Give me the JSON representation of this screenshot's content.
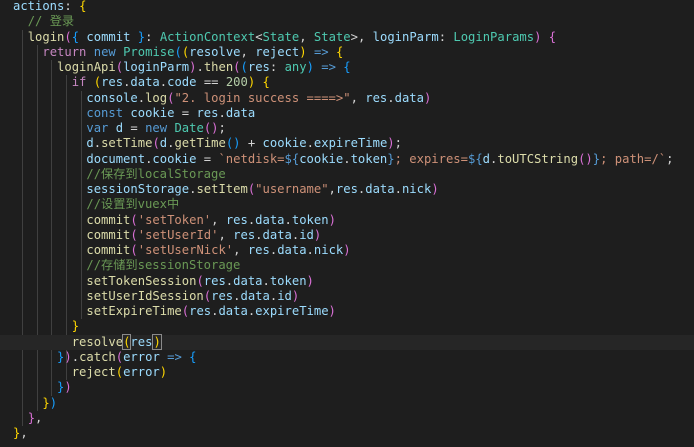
{
  "colors": {
    "background": "#1e1e1e",
    "default": "#d4d4d4",
    "keyword": "#569cd6",
    "control": "#c586c0",
    "variable": "#9cdcfe",
    "function": "#dcdcaa",
    "type": "#4ec9b0",
    "string": "#ce9178",
    "number": "#b5cea8",
    "comment": "#6a9955",
    "bracket1": "#ffd700",
    "bracket2": "#da70d6",
    "bracket3": "#179fff"
  },
  "lines": [
    {
      "tokens": [
        [
          "actions",
          "variable"
        ],
        [
          ": ",
          "default"
        ],
        [
          "{",
          "bracket1"
        ]
      ]
    },
    {
      "tokens": [
        [
          "  ",
          "default"
        ],
        [
          "// 登录",
          "comment"
        ]
      ]
    },
    {
      "tokens": [
        [
          "  ",
          "default"
        ],
        [
          "login",
          "function"
        ],
        [
          "(",
          "bracket2"
        ],
        [
          "{ ",
          "bracket3"
        ],
        [
          "commit ",
          "variable"
        ],
        [
          "}",
          "bracket3"
        ],
        [
          ": ",
          "default"
        ],
        [
          "ActionContext",
          "type"
        ],
        [
          "<",
          "default"
        ],
        [
          "State",
          "type"
        ],
        [
          ", ",
          "default"
        ],
        [
          "State",
          "type"
        ],
        [
          ">",
          "default"
        ],
        [
          ", ",
          "default"
        ],
        [
          "loginParm",
          "variable"
        ],
        [
          ": ",
          "default"
        ],
        [
          "LoginParams",
          "type"
        ],
        [
          ")",
          "bracket2"
        ],
        [
          " ",
          "default"
        ],
        [
          "{",
          "bracket2"
        ]
      ]
    },
    {
      "tokens": [
        [
          "    ",
          "default"
        ],
        [
          "return ",
          "control"
        ],
        [
          "new ",
          "keyword"
        ],
        [
          "Promise",
          "type"
        ],
        [
          "(",
          "bracket3"
        ],
        [
          "(",
          "bracket1"
        ],
        [
          "resolve",
          "variable"
        ],
        [
          ", ",
          "default"
        ],
        [
          "reject",
          "variable"
        ],
        [
          ")",
          "bracket1"
        ],
        [
          " ",
          "default"
        ],
        [
          "=>",
          "keyword"
        ],
        [
          " ",
          "default"
        ],
        [
          "{",
          "bracket1"
        ]
      ]
    },
    {
      "tokens": [
        [
          "      ",
          "default"
        ],
        [
          "loginApi",
          "function"
        ],
        [
          "(",
          "bracket2"
        ],
        [
          "loginParm",
          "variable"
        ],
        [
          ")",
          "bracket2"
        ],
        [
          ".",
          "default"
        ],
        [
          "then",
          "function"
        ],
        [
          "(",
          "bracket2"
        ],
        [
          "(",
          "bracket3"
        ],
        [
          "res",
          "variable"
        ],
        [
          ": ",
          "default"
        ],
        [
          "any",
          "type"
        ],
        [
          ")",
          "bracket3"
        ],
        [
          " ",
          "default"
        ],
        [
          "=>",
          "keyword"
        ],
        [
          " ",
          "default"
        ],
        [
          "{",
          "bracket3"
        ]
      ]
    },
    {
      "tokens": [
        [
          "        ",
          "default"
        ],
        [
          "if ",
          "control"
        ],
        [
          "(",
          "bracket1"
        ],
        [
          "res",
          "variable"
        ],
        [
          ".",
          "default"
        ],
        [
          "data",
          "variable"
        ],
        [
          ".",
          "default"
        ],
        [
          "code",
          "variable"
        ],
        [
          " == ",
          "default"
        ],
        [
          "200",
          "number"
        ],
        [
          ")",
          "bracket1"
        ],
        [
          " ",
          "default"
        ],
        [
          "{",
          "bracket1"
        ]
      ]
    },
    {
      "tokens": [
        [
          "          ",
          "default"
        ],
        [
          "console",
          "variable"
        ],
        [
          ".",
          "default"
        ],
        [
          "log",
          "function"
        ],
        [
          "(",
          "bracket2"
        ],
        [
          "\"2. login success ====>\"",
          "string"
        ],
        [
          ", ",
          "default"
        ],
        [
          "res",
          "variable"
        ],
        [
          ".",
          "default"
        ],
        [
          "data",
          "variable"
        ],
        [
          ")",
          "bracket2"
        ]
      ]
    },
    {
      "tokens": [
        [
          "          ",
          "default"
        ],
        [
          "const ",
          "keyword"
        ],
        [
          "cookie",
          "variable"
        ],
        [
          " = ",
          "default"
        ],
        [
          "res",
          "variable"
        ],
        [
          ".",
          "default"
        ],
        [
          "data",
          "variable"
        ]
      ]
    },
    {
      "tokens": [
        [
          "          ",
          "default"
        ],
        [
          "var ",
          "keyword"
        ],
        [
          "d",
          "variable"
        ],
        [
          " = ",
          "default"
        ],
        [
          "new ",
          "keyword"
        ],
        [
          "Date",
          "type"
        ],
        [
          "()",
          "bracket2"
        ],
        [
          ";",
          "default"
        ]
      ]
    },
    {
      "tokens": [
        [
          "          ",
          "default"
        ],
        [
          "d",
          "variable"
        ],
        [
          ".",
          "default"
        ],
        [
          "setTime",
          "function"
        ],
        [
          "(",
          "bracket2"
        ],
        [
          "d",
          "variable"
        ],
        [
          ".",
          "default"
        ],
        [
          "getTime",
          "function"
        ],
        [
          "()",
          "bracket3"
        ],
        [
          " + ",
          "default"
        ],
        [
          "cookie",
          "variable"
        ],
        [
          ".",
          "default"
        ],
        [
          "expireTime",
          "variable"
        ],
        [
          ")",
          "bracket2"
        ],
        [
          ";",
          "default"
        ]
      ]
    },
    {
      "tokens": [
        [
          "          ",
          "default"
        ],
        [
          "document",
          "variable"
        ],
        [
          ".",
          "default"
        ],
        [
          "cookie",
          "variable"
        ],
        [
          " = ",
          "default"
        ],
        [
          "`netdisk=",
          "string"
        ],
        [
          "${",
          "keyword"
        ],
        [
          "cookie",
          "variable"
        ],
        [
          ".",
          "default"
        ],
        [
          "token",
          "variable"
        ],
        [
          "}",
          "keyword"
        ],
        [
          "; expires=",
          "string"
        ],
        [
          "${",
          "keyword"
        ],
        [
          "d",
          "variable"
        ],
        [
          ".",
          "default"
        ],
        [
          "toUTCString",
          "function"
        ],
        [
          "()",
          "bracket2"
        ],
        [
          "}",
          "keyword"
        ],
        [
          "; path=/`",
          "string"
        ],
        [
          ";",
          "default"
        ]
      ]
    },
    {
      "tokens": [
        [
          "          ",
          "default"
        ],
        [
          "//保存到localStorage",
          "comment"
        ]
      ]
    },
    {
      "tokens": [
        [
          "          ",
          "default"
        ],
        [
          "sessionStorage",
          "variable"
        ],
        [
          ".",
          "default"
        ],
        [
          "setItem",
          "function"
        ],
        [
          "(",
          "bracket2"
        ],
        [
          "\"username\"",
          "string"
        ],
        [
          ",",
          "default"
        ],
        [
          "res",
          "variable"
        ],
        [
          ".",
          "default"
        ],
        [
          "data",
          "variable"
        ],
        [
          ".",
          "default"
        ],
        [
          "nick",
          "variable"
        ],
        [
          ")",
          "bracket2"
        ]
      ]
    },
    {
      "tokens": [
        [
          "          ",
          "default"
        ],
        [
          "//设置到vuex中",
          "comment"
        ]
      ]
    },
    {
      "tokens": [
        [
          "          ",
          "default"
        ],
        [
          "commit",
          "function"
        ],
        [
          "(",
          "bracket2"
        ],
        [
          "'setToken'",
          "string"
        ],
        [
          ", ",
          "default"
        ],
        [
          "res",
          "variable"
        ],
        [
          ".",
          "default"
        ],
        [
          "data",
          "variable"
        ],
        [
          ".",
          "default"
        ],
        [
          "token",
          "variable"
        ],
        [
          ")",
          "bracket2"
        ]
      ]
    },
    {
      "tokens": [
        [
          "          ",
          "default"
        ],
        [
          "commit",
          "function"
        ],
        [
          "(",
          "bracket2"
        ],
        [
          "'setUserId'",
          "string"
        ],
        [
          ", ",
          "default"
        ],
        [
          "res",
          "variable"
        ],
        [
          ".",
          "default"
        ],
        [
          "data",
          "variable"
        ],
        [
          ".",
          "default"
        ],
        [
          "id",
          "variable"
        ],
        [
          ")",
          "bracket2"
        ]
      ]
    },
    {
      "tokens": [
        [
          "          ",
          "default"
        ],
        [
          "commit",
          "function"
        ],
        [
          "(",
          "bracket2"
        ],
        [
          "'setUserNick'",
          "string"
        ],
        [
          ", ",
          "default"
        ],
        [
          "res",
          "variable"
        ],
        [
          ".",
          "default"
        ],
        [
          "data",
          "variable"
        ],
        [
          ".",
          "default"
        ],
        [
          "nick",
          "variable"
        ],
        [
          ")",
          "bracket2"
        ]
      ]
    },
    {
      "tokens": [
        [
          "          ",
          "default"
        ],
        [
          "//存储到sessionStorage",
          "comment"
        ]
      ]
    },
    {
      "tokens": [
        [
          "          ",
          "default"
        ],
        [
          "setTokenSession",
          "function"
        ],
        [
          "(",
          "bracket2"
        ],
        [
          "res",
          "variable"
        ],
        [
          ".",
          "default"
        ],
        [
          "data",
          "variable"
        ],
        [
          ".",
          "default"
        ],
        [
          "token",
          "variable"
        ],
        [
          ")",
          "bracket2"
        ]
      ]
    },
    {
      "tokens": [
        [
          "          ",
          "default"
        ],
        [
          "setUserIdSession",
          "function"
        ],
        [
          "(",
          "bracket2"
        ],
        [
          "res",
          "variable"
        ],
        [
          ".",
          "default"
        ],
        [
          "data",
          "variable"
        ],
        [
          ".",
          "default"
        ],
        [
          "id",
          "variable"
        ],
        [
          ")",
          "bracket2"
        ]
      ]
    },
    {
      "tokens": [
        [
          "          ",
          "default"
        ],
        [
          "setExpireTime",
          "function"
        ],
        [
          "(",
          "bracket2"
        ],
        [
          "res",
          "variable"
        ],
        [
          ".",
          "default"
        ],
        [
          "data",
          "variable"
        ],
        [
          ".",
          "default"
        ],
        [
          "expireTime",
          "variable"
        ],
        [
          ")",
          "bracket2"
        ]
      ]
    },
    {
      "tokens": [
        [
          "        ",
          "default"
        ],
        [
          "}",
          "bracket1"
        ]
      ]
    },
    {
      "tokens": [
        [
          "        ",
          "default"
        ],
        [
          "resolve",
          "function"
        ],
        [
          "(",
          "bracket1"
        ],
        [
          "res",
          "variable"
        ],
        [
          ")",
          "bracket1"
        ]
      ]
    },
    {
      "tokens": [
        [
          "      ",
          "default"
        ],
        [
          "}",
          "bracket3"
        ],
        [
          ")",
          "bracket2"
        ],
        [
          ".",
          "default"
        ],
        [
          "catch",
          "function"
        ],
        [
          "(",
          "bracket2"
        ],
        [
          "error",
          "variable"
        ],
        [
          " ",
          "default"
        ],
        [
          "=>",
          "keyword"
        ],
        [
          " ",
          "default"
        ],
        [
          "{",
          "bracket3"
        ]
      ]
    },
    {
      "tokens": [
        [
          "        ",
          "default"
        ],
        [
          "reject",
          "function"
        ],
        [
          "(",
          "bracket1"
        ],
        [
          "error",
          "variable"
        ],
        [
          ")",
          "bracket1"
        ]
      ]
    },
    {
      "tokens": [
        [
          "      ",
          "default"
        ],
        [
          "}",
          "bracket3"
        ],
        [
          ")",
          "bracket2"
        ]
      ]
    },
    {
      "tokens": [
        [
          "    ",
          "default"
        ],
        [
          "}",
          "bracket1"
        ],
        [
          ")",
          "bracket3"
        ]
      ]
    },
    {
      "tokens": [
        [
          "  ",
          "default"
        ],
        [
          "}",
          "bracket2"
        ],
        [
          ",",
          "default"
        ]
      ]
    },
    {
      "tokens": [
        [
          "}",
          "bracket1"
        ],
        [
          ",",
          "default"
        ]
      ]
    }
  ]
}
